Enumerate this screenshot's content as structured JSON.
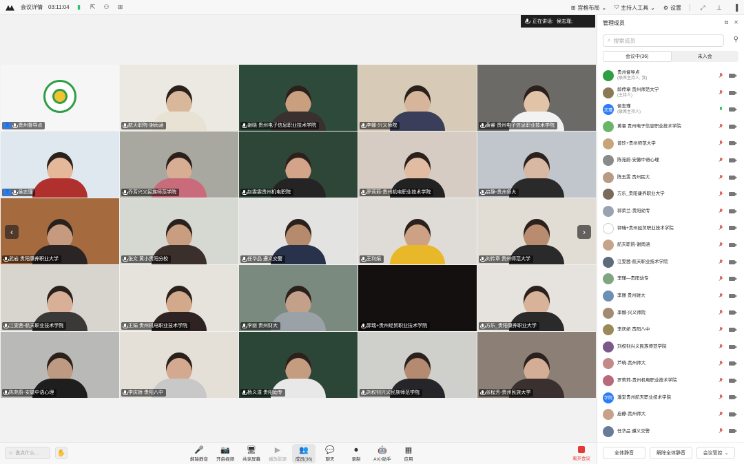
{
  "titlebar": {
    "meeting_info": "会议详情",
    "duration": "03:11:04",
    "layout_label": "宫格布局",
    "host_tools_label": "主持人工具",
    "settings_label": "设置"
  },
  "speaking": {
    "label": "正在讲话:",
    "name": "侯志瑾;"
  },
  "tiles": [
    {
      "name": "贵州督导点",
      "host": true,
      "bg": "#f6f6f6",
      "kind": "logo"
    },
    {
      "name": "航天职院-谢雨涵",
      "bg": "#ece8e2",
      "skin": "#d9b79b",
      "cloth": "#e8e2d5"
    },
    {
      "name": "谢晓 贵州电子信息职业技术学院",
      "bg": "#2e4a3a",
      "skin": "#c99f80",
      "cloth": "#3a3030"
    },
    {
      "name": "李娜-兴义师院",
      "bg": "#d7cab7",
      "skin": "#d6b59b",
      "cloth": "#3b3e5a"
    },
    {
      "name": "黄睿 贵州电子信息职业技术学院",
      "bg": "#6c6a66",
      "skin": "#e1c3a8",
      "cloth": "#f2f2f2"
    },
    {
      "name": "侯志瑾",
      "host": true,
      "bg": "#dfe7ef",
      "skin": "#e6b89a",
      "cloth": "#b0302d",
      "selected": true
    },
    {
      "name": "乔芳兴义民族师范学院",
      "bg": "#a8a8a0",
      "skin": "#d7ad94",
      "cloth": "#c96b7b"
    },
    {
      "name": "赵雯雯贵州机电职院",
      "bg": "#2e4638",
      "skin": "#d3a489",
      "cloth": "#242424"
    },
    {
      "name": "罗莉莉-贵州机电职业技术学院",
      "bg": "#d6ccc4",
      "skin": "#e1bca3",
      "cloth": "#222"
    },
    {
      "name": "启静-贵州师大",
      "bg": "#c1c6cc",
      "skin": "#d8b8a2",
      "cloth": "#2a2a2a"
    },
    {
      "name": "武岩 贵阳康养职业大学",
      "bg": "#a56b3f",
      "skin": "#c69a7e",
      "cloth": "#2a2424"
    },
    {
      "name": "张文 黄小贵阳分校",
      "bg": "#d6d8d2",
      "skin": "#c99d80",
      "cloth": "#3b2f2c"
    },
    {
      "name": "任华品 遵义交警",
      "bg": "#e3e3e1",
      "skin": "#b68a6c",
      "cloth": "#28324a"
    },
    {
      "name": "王利娟",
      "bg": "#dfdcd7",
      "skin": "#cda183",
      "cloth": "#e9b82a"
    },
    {
      "name": "刘传章 贵州师范大学",
      "bg": "#e1ddd5",
      "skin": "#b98c70",
      "cloth": "#2a2a2a"
    },
    {
      "name": "江雯茜-航天职业技术学院",
      "bg": "#d8d4ce",
      "skin": "#d8b098",
      "cloth": "#3b3838"
    },
    {
      "name": "王娟 贵州机电职业技术学院",
      "bg": "#e6e2dc",
      "skin": "#d3a98b",
      "cloth": "#2e2222"
    },
    {
      "name": "李丽 贵州财大",
      "bg": "#7a8a7e",
      "skin": "#c2a08a",
      "cloth": "#9aa2a8"
    },
    {
      "name": "郭瑞+贵州经贸职业技术学院",
      "bg": "#151010",
      "skin": "#151010",
      "cloth": "#151010",
      "dark": true
    },
    {
      "name": "方乐_贵阳康养职业大学",
      "bg": "#e6e3de",
      "skin": "#d8b39a",
      "cloth": "#2a2a2a"
    },
    {
      "name": "陈苑蔚-安徽中语心理",
      "bg": "#b9bab8",
      "skin": "#bf9a83",
      "cloth": "#1e1e1e"
    },
    {
      "name": "李庆娇 贵阳八中",
      "bg": "#e4e0d8",
      "skin": "#d3aa8f",
      "cloth": "#c8c8c8"
    },
    {
      "name": "杨义潼 贵阳幼专",
      "bg": "#2b4536",
      "skin": "#c49c80",
      "cloth": "#e8e8e8"
    },
    {
      "name": "刘权钊兴义民族师范学院",
      "bg": "#cfcfcc",
      "skin": "#b48a70",
      "cloth": "#26262a"
    },
    {
      "name": "张程芳-贵州民族大学",
      "bg": "#8b7f76",
      "skin": "#d3ad95",
      "cloth": "#3b3030"
    }
  ],
  "toolbar": {
    "chat_placeholder": "说点什么...",
    "items": [
      {
        "label": "解除静音",
        "icon": "🎤"
      },
      {
        "label": "开启视频",
        "icon": "📷"
      },
      {
        "label": "共享屏幕",
        "icon": "🖥"
      },
      {
        "label": "播放影源",
        "icon": "▶",
        "disabled": true
      },
      {
        "label": "成员(36)",
        "icon": "👥",
        "active": true
      },
      {
        "label": "聊天",
        "icon": "💬",
        "badge": "2"
      },
      {
        "label": "录制",
        "icon": "⏺"
      },
      {
        "label": "AI小助手",
        "icon": "🤖"
      },
      {
        "label": "应用",
        "icon": "▦"
      }
    ],
    "leave_label": "离开会议"
  },
  "panel": {
    "title": "管理成员",
    "search_placeholder": "搜索成员",
    "tab_in": "会议中(36)",
    "tab_out": "未入会",
    "members": [
      {
        "name": "贵州督导点",
        "sub": "(联席主持人, 我)",
        "color": "#2f9e44",
        "mic_on": false
      },
      {
        "name": "郎传章 贵州师范大学",
        "sub": "(主持人)",
        "color": "#8a7a55",
        "mic_on": false
      },
      {
        "name": "侯志瑾",
        "sub": "(联席主持人)",
        "color": "#2d7cf6",
        "initial": "志瑾",
        "mic_on": true
      },
      {
        "name": "黄睿 贵州电子信息职业技术学院",
        "color": "#6bb56b",
        "mic_on": false
      },
      {
        "name": "曾珍+贵州师范大学",
        "color": "#c9a47a",
        "mic_on": false
      },
      {
        "name": "陈苑蔚-安徽中语心理",
        "color": "#8a8a8a",
        "mic_on": false
      },
      {
        "name": "陈玉雯 贵州民大",
        "color": "#b89a86",
        "mic_on": false
      },
      {
        "name": "方乐_贵阳康养职业大学",
        "color": "#7a6a5a",
        "mic_on": false
      },
      {
        "name": "郭荣兰-贵阳幼专",
        "color": "#9aa4b0",
        "mic_on": false
      },
      {
        "name": "郭瑞+贵州经贸职业技术学院",
        "color": "#ffffff",
        "mic_on": false
      },
      {
        "name": "航天职院-谢雨涵",
        "color": "#c7a38a",
        "mic_on": false
      },
      {
        "name": "江雯茜-航天职业技术学院",
        "color": "#5d6b7a",
        "mic_on": false
      },
      {
        "name": "李瑾—贵阳幼专",
        "color": "#7fa67f",
        "mic_on": false
      },
      {
        "name": "李丽 贵州财大",
        "color": "#6d8fb5",
        "mic_on": false
      },
      {
        "name": "李娜-兴义师院",
        "color": "#a38b73",
        "mic_on": false
      },
      {
        "name": "李庆娇 贵阳八中",
        "color": "#9a8a5a",
        "mic_on": false
      },
      {
        "name": "刘权钊兴义民族师范学院",
        "color": "#7a5a8a",
        "mic_on": false
      },
      {
        "name": "芦晓-贵州师大",
        "color": "#c28a8a",
        "mic_on": false
      },
      {
        "name": "罗莉莉-贵州机电职业技术学院",
        "color": "#b86a7a",
        "mic_on": false
      },
      {
        "name": "潘堂贵州航天职业技术学院",
        "color": "#2d7cf6",
        "initial": "学院",
        "mic_on": false
      },
      {
        "name": "启静-贵州师大",
        "color": "#c9a08a",
        "mic_on": false
      },
      {
        "name": "任华品 遵义交警",
        "color": "#6a7a9a",
        "mic_on": false
      }
    ],
    "mute_all": "全体静音",
    "unmute_all": "解除全体静音",
    "controls": "会议管控"
  }
}
